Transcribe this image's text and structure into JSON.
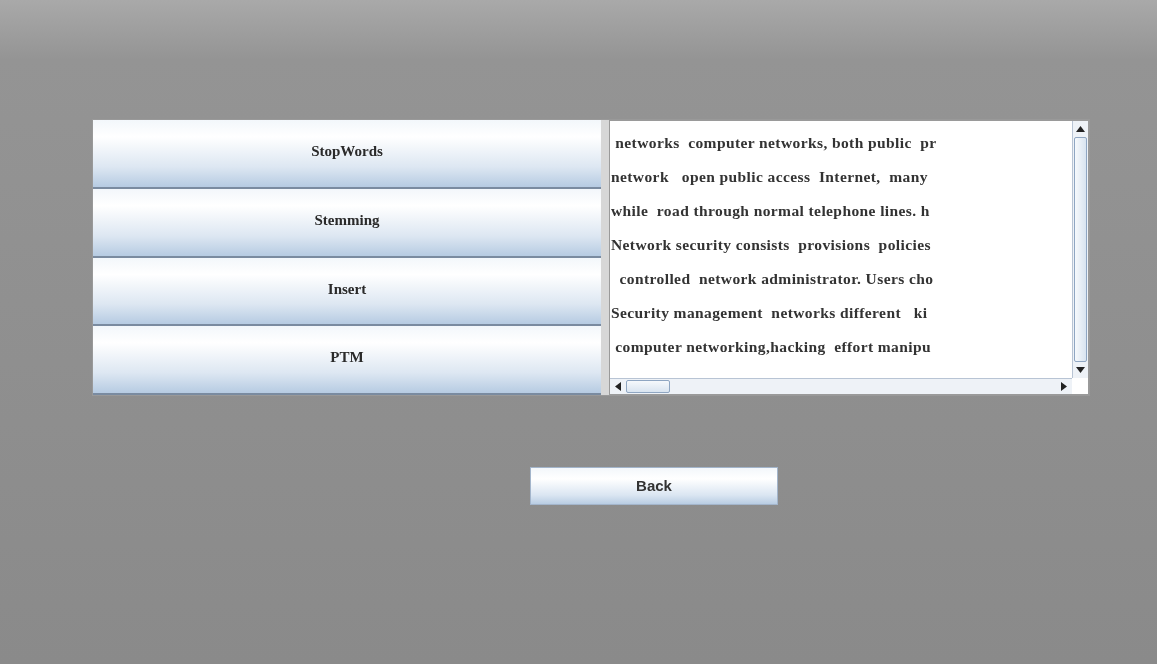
{
  "menu_buttons": [
    {
      "label": "StopWords"
    },
    {
      "label": "Stemming"
    },
    {
      "label": "Insert"
    },
    {
      "label": "PTM"
    }
  ],
  "text_area": {
    "lines": [
      " networks  computer networks, both public  pr",
      "network   open public access  Internet,  many",
      "while  road through normal telephone lines. h",
      "Network security consists  provisions  policies",
      "  controlled  network administrator. Users cho",
      "Security management  networks different   ki",
      " computer networking,hacking  effort manipu"
    ]
  },
  "back_button": {
    "label": "Back"
  }
}
